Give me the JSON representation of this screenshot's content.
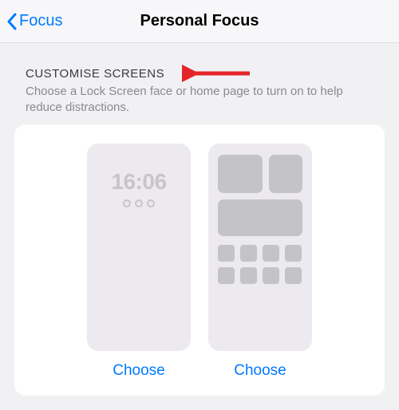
{
  "header": {
    "back_label": "Focus",
    "title": "Personal Focus"
  },
  "section": {
    "header": "CUSTOMISE SCREENS",
    "description": "Choose a Lock Screen face or home page to turn on to help reduce distractions."
  },
  "lockscreen": {
    "time": "16:06"
  },
  "buttons": {
    "choose_lock": "Choose",
    "choose_home": "Choose"
  },
  "annotation": {
    "arrow_color": "#e2252b"
  }
}
